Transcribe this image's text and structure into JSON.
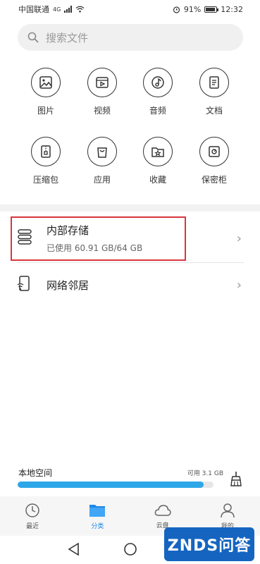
{
  "status_bar": {
    "carrier": "中国联通",
    "network": "4G",
    "battery": "91%",
    "time": "12:32"
  },
  "search": {
    "placeholder": "搜索文件"
  },
  "categories": [
    {
      "label": "图片",
      "icon": "image-icon"
    },
    {
      "label": "视频",
      "icon": "video-icon"
    },
    {
      "label": "音频",
      "icon": "audio-icon"
    },
    {
      "label": "文档",
      "icon": "document-icon"
    },
    {
      "label": "压缩包",
      "icon": "archive-icon"
    },
    {
      "label": "应用",
      "icon": "app-bag-icon"
    },
    {
      "label": "收藏",
      "icon": "star-folder-icon"
    },
    {
      "label": "保密柜",
      "icon": "safe-icon"
    }
  ],
  "storage": {
    "title": "内部存储",
    "usage": "已使用 60.91 GB/64 GB",
    "highlight_color": "#d9363e"
  },
  "network": {
    "title": "网络邻居"
  },
  "local_space": {
    "title": "本地空间",
    "available": "可用 3.1 GB",
    "used_fraction": 0.95,
    "bar_color": "#2da7e8"
  },
  "tabs": [
    {
      "label": "最近",
      "icon": "clock-icon",
      "active": false
    },
    {
      "label": "分类",
      "icon": "folder-icon",
      "active": true
    },
    {
      "label": "云盘",
      "icon": "cloud-icon",
      "active": false
    },
    {
      "label": "我的",
      "icon": "person-icon",
      "active": false
    }
  ],
  "watermark": {
    "text": "ZNDS问答"
  },
  "accent_color": "#1e88e5"
}
